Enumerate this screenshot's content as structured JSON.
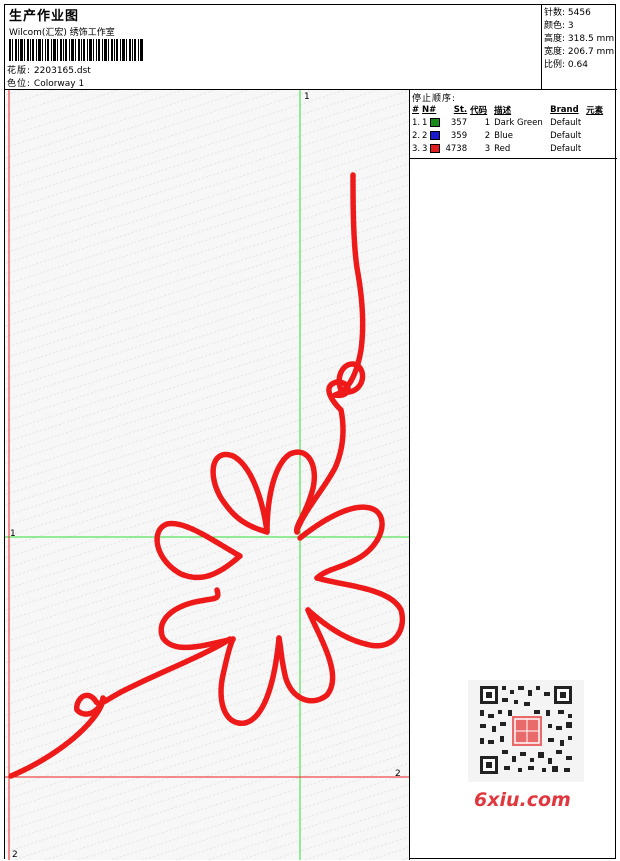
{
  "header": {
    "title": "生产作业图",
    "subtitle": "Wilcom(汇宏) 绣饰工作室",
    "file_label": "花版:",
    "file_value": "2203165.dst",
    "colorway_label": "色位:",
    "colorway_value": "Colorway 1"
  },
  "stats": [
    {
      "label": "针数:",
      "value": "5456"
    },
    {
      "label": "颜色:",
      "value": "3"
    },
    {
      "label": "高度:",
      "value": "318.5 mm"
    },
    {
      "label": "宽度:",
      "value": "206.7 mm"
    },
    {
      "label": "比例:",
      "value": "0.64"
    }
  ],
  "stop_sequence": {
    "title": "停止顺序:",
    "columns": {
      "num": "#",
      "n": "N#",
      "st": "St.",
      "code": "代码",
      "desc": "描述",
      "brand": "Brand",
      "elem": "元素"
    },
    "rows": [
      {
        "num": "1.",
        "n": "1",
        "color": "#1a8a1a",
        "st": "357",
        "code": "1",
        "desc": "Dark Green",
        "brand": "Default"
      },
      {
        "num": "2.",
        "n": "2",
        "color": "#1a1ad0",
        "st": "359",
        "code": "2",
        "desc": "Blue",
        "brand": "Default"
      },
      {
        "num": "3.",
        "n": "3",
        "color": "#e02020",
        "st": "4738",
        "code": "3",
        "desc": "Red",
        "brand": "Default"
      }
    ]
  },
  "axis_labels": {
    "top": "1",
    "left": "1",
    "right": "2",
    "bottom": "2"
  },
  "colors": {
    "stitch": "#ee1a1a",
    "guide_green": "#33dd33",
    "guide_red": "#ee2222"
  },
  "watermark": "6xiu.com"
}
